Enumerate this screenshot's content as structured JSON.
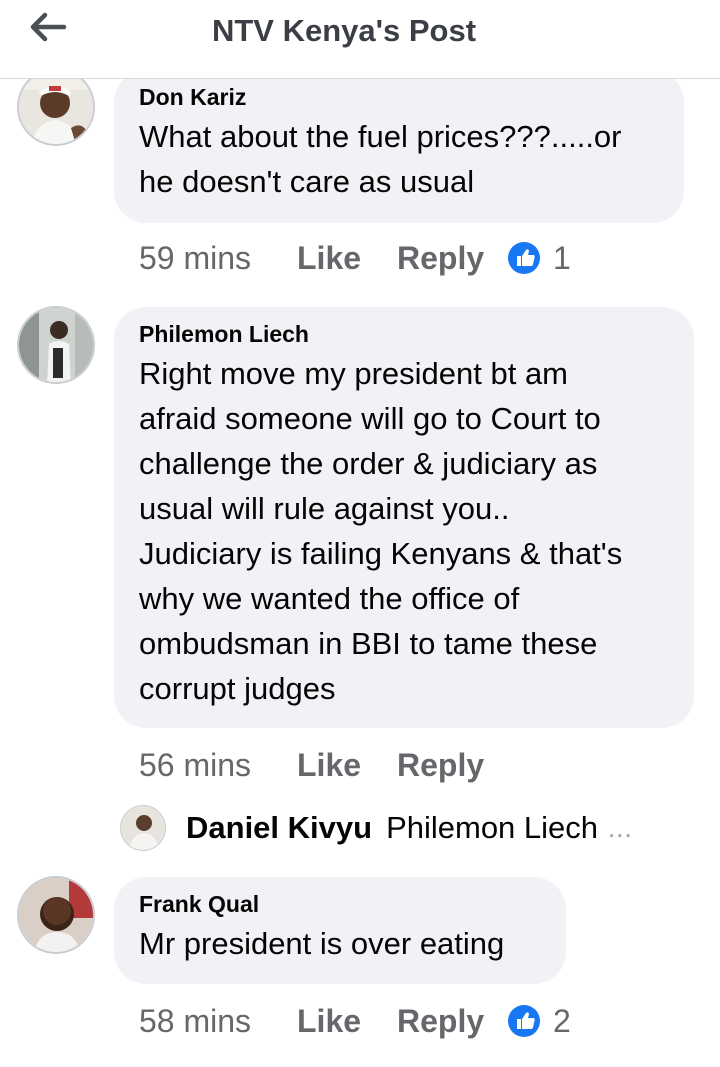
{
  "header": {
    "title": "NTV Kenya's Post",
    "back_icon": "arrow-left-icon"
  },
  "colors": {
    "like_blue": "#1877f2",
    "bubble_bg": "#f0f2f5",
    "meta_gray": "#65676b"
  },
  "comments": [
    {
      "author": "Don Kariz",
      "lines": [
        "What about the fuel prices???.....or",
        "he doesn't care as usual"
      ],
      "time": "59 mins",
      "like_label": "Like",
      "reply_label": "Reply",
      "reaction_icon": "thumbs-up-icon",
      "reaction_count": "1"
    },
    {
      "author": "Philemon Liech",
      "lines": [
        "Right move my president bt am",
        "afraid someone will go to Court to",
        "challenge the order & judiciary as",
        "usual will rule against you..",
        "Judiciary is failing Kenyans & that's",
        "why we wanted the office of",
        "ombudsman in BBI to tame these",
        "corrupt judges"
      ],
      "time": "56 mins",
      "like_label": "Like",
      "reply_label": "Reply",
      "reply_preview": {
        "author": "Daniel Kivyu",
        "text": "Philemon Liech",
        "ellipsis": "..."
      }
    },
    {
      "author": "Frank Qual",
      "lines": [
        "Mr president is over eating"
      ],
      "time": "58 mins",
      "like_label": "Like",
      "reply_label": "Reply",
      "reaction_icon": "thumbs-up-icon",
      "reaction_count": "2"
    }
  ]
}
